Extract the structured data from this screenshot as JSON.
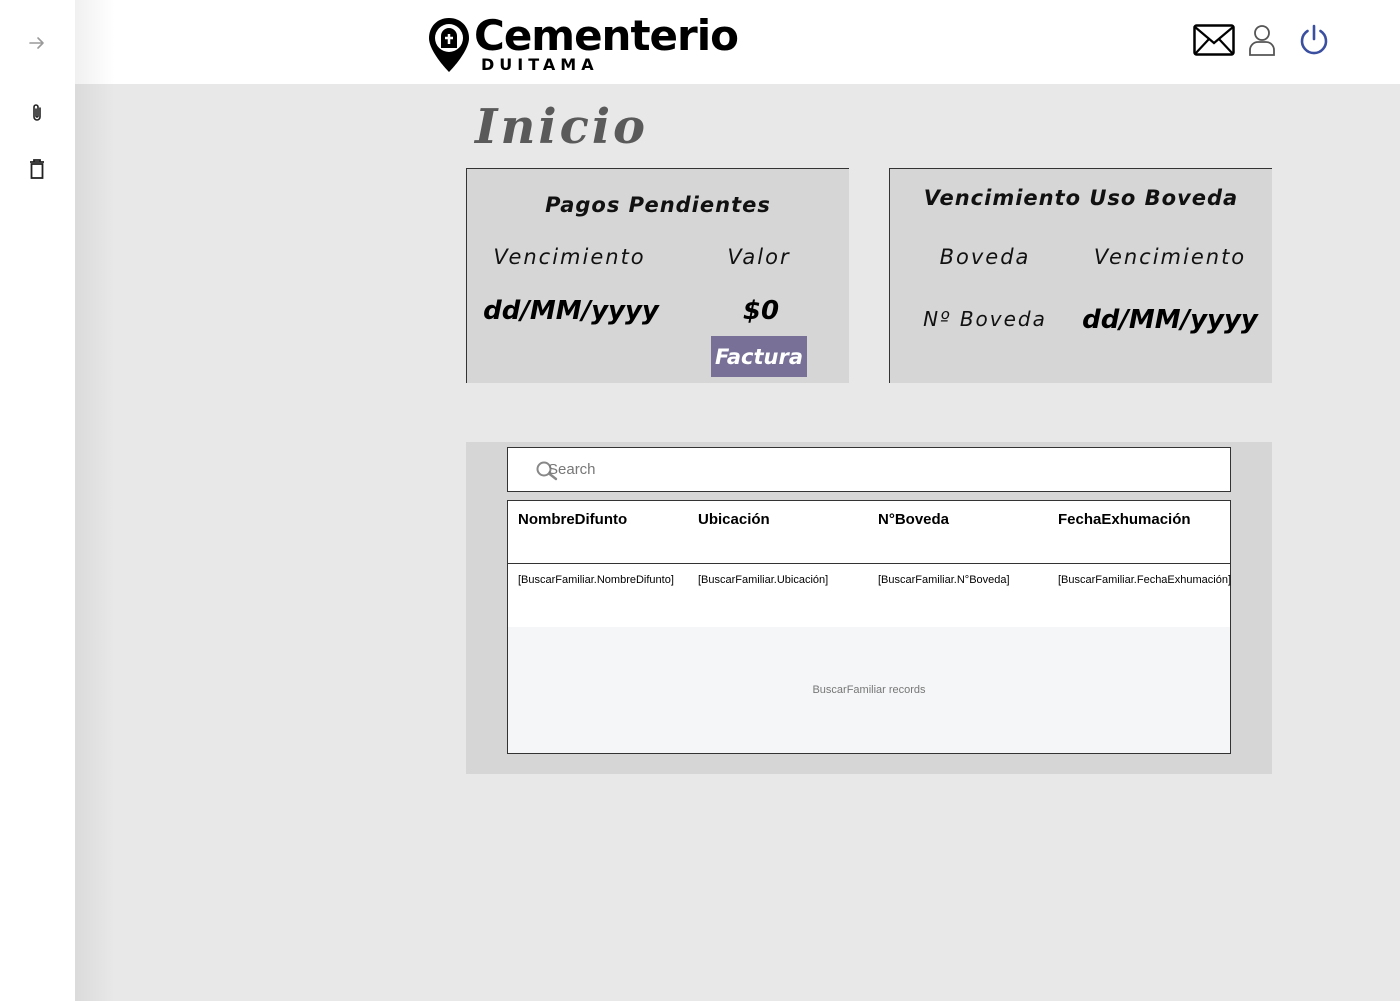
{
  "app": {
    "logo_title": "Cementerio",
    "logo_subtitle": "DUITAMA"
  },
  "sidebar": {
    "icons": [
      "arrow-right-icon",
      "paperclip-icon",
      "trash-icon"
    ]
  },
  "header": {
    "icons": [
      "mail-icon",
      "user-icon",
      "power-icon"
    ]
  },
  "page": {
    "title": "Inicio"
  },
  "pagos_card": {
    "title": "Pagos Pendientes",
    "label_vencimiento": "Vencimiento",
    "label_valor": "Valor",
    "value_fecha": "dd/MM/yyyy",
    "value_valor": "$0",
    "factura_label": "Factura"
  },
  "boveda_card": {
    "title": "Vencimiento Uso Boveda",
    "label_boveda": "Boveda",
    "label_vencimiento": "Vencimiento",
    "value_boveda": "Nº Boveda",
    "value_fecha": "dd/MM/yyyy"
  },
  "search": {
    "placeholder": "Search",
    "value": ""
  },
  "table": {
    "columns": [
      "NombreDifunto",
      "Ubicación",
      "N°Boveda",
      "FechaExhumación"
    ],
    "rows": [
      [
        "[BuscarFamiliar.NombreDifunto]",
        "[BuscarFamiliar.Ubicación]",
        "[BuscarFamiliar.N°Boveda]",
        "[BuscarFamiliar.FechaExhumación]"
      ]
    ],
    "footer_text": "BuscarFamiliar records"
  },
  "colors": {
    "accent_button": "#787097",
    "power_icon": "#3b4fa0",
    "main_bg": "#e8e8e8",
    "card_bg": "#d6d6d6"
  }
}
